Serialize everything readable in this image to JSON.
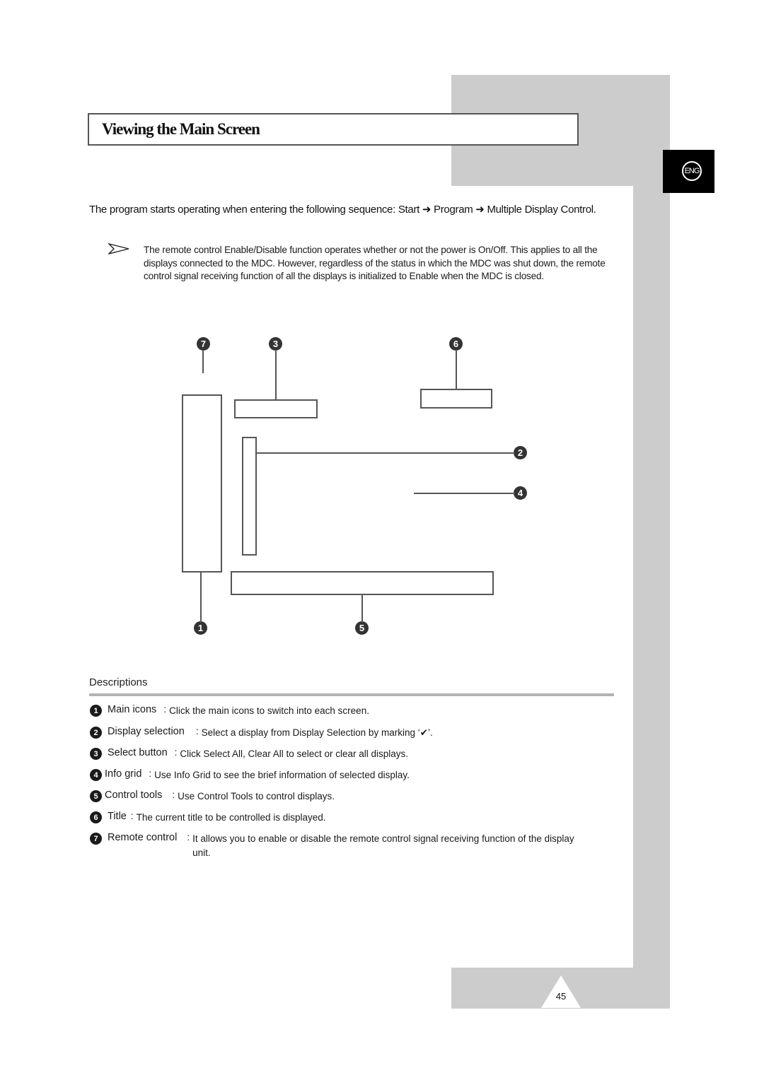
{
  "page": {
    "title": "Viewing the Main Screen",
    "language_badge": "ENG",
    "page_number": "45"
  },
  "intro": {
    "text": "The program starts operating when entering the following sequence: Start ➜ Program ➜ Multiple Display Control."
  },
  "note": {
    "icon": "note-arrow-icon",
    "text": "The remote control Enable/Disable function operates whether or not the power is On/Off. This applies to all the displays connected to the MDC. However, regardless of the status in which the MDC was shut down, the remote control signal receiving function of all the displays is initialized to Enable when the MDC is closed."
  },
  "diagram": {
    "markers": {
      "m1": "1",
      "m2": "2",
      "m3": "3",
      "m4": "4",
      "m5": "5",
      "m6": "6",
      "m7": "7"
    }
  },
  "descriptions": {
    "heading": "Descriptions",
    "items": [
      {
        "num": "1",
        "term": "Main icons",
        "sep": ":",
        "def": "Click the main icons to switch into each screen."
      },
      {
        "num": "2",
        "term": "Display selection",
        "sep": ":",
        "def": "Select a display from Display Selection by marking ‘✔’."
      },
      {
        "num": "3",
        "term": "Select button",
        "sep": ":",
        "def": "Click Select All, Clear All to select or clear all displays."
      },
      {
        "num": "4",
        "term": "Info grid",
        "sep": ":",
        "def": "Use Info Grid to see the brief information of selected display."
      },
      {
        "num": "5",
        "term": "Control tools",
        "sep": ":",
        "def": "Use Control Tools to control displays."
      },
      {
        "num": "6",
        "term": "Title",
        "sep": ":",
        "def": "The current title to be controlled is displayed."
      },
      {
        "num": "7",
        "term": "Remote control",
        "sep": ":",
        "def": "It allows you to enable or disable the remote control signal receiving function of the display unit."
      }
    ]
  }
}
